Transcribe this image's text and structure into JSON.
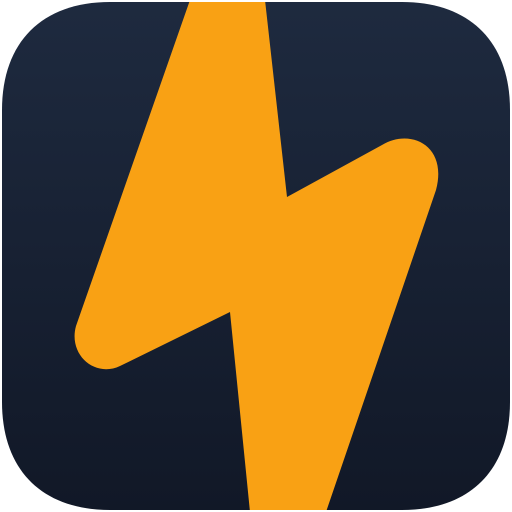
{
  "app_icon": {
    "icon_name": "lightning-bolt-icon",
    "colors": {
      "background_top": "#1E2A3F",
      "background_bottom": "#111827",
      "bolt": "#F9A114"
    }
  }
}
